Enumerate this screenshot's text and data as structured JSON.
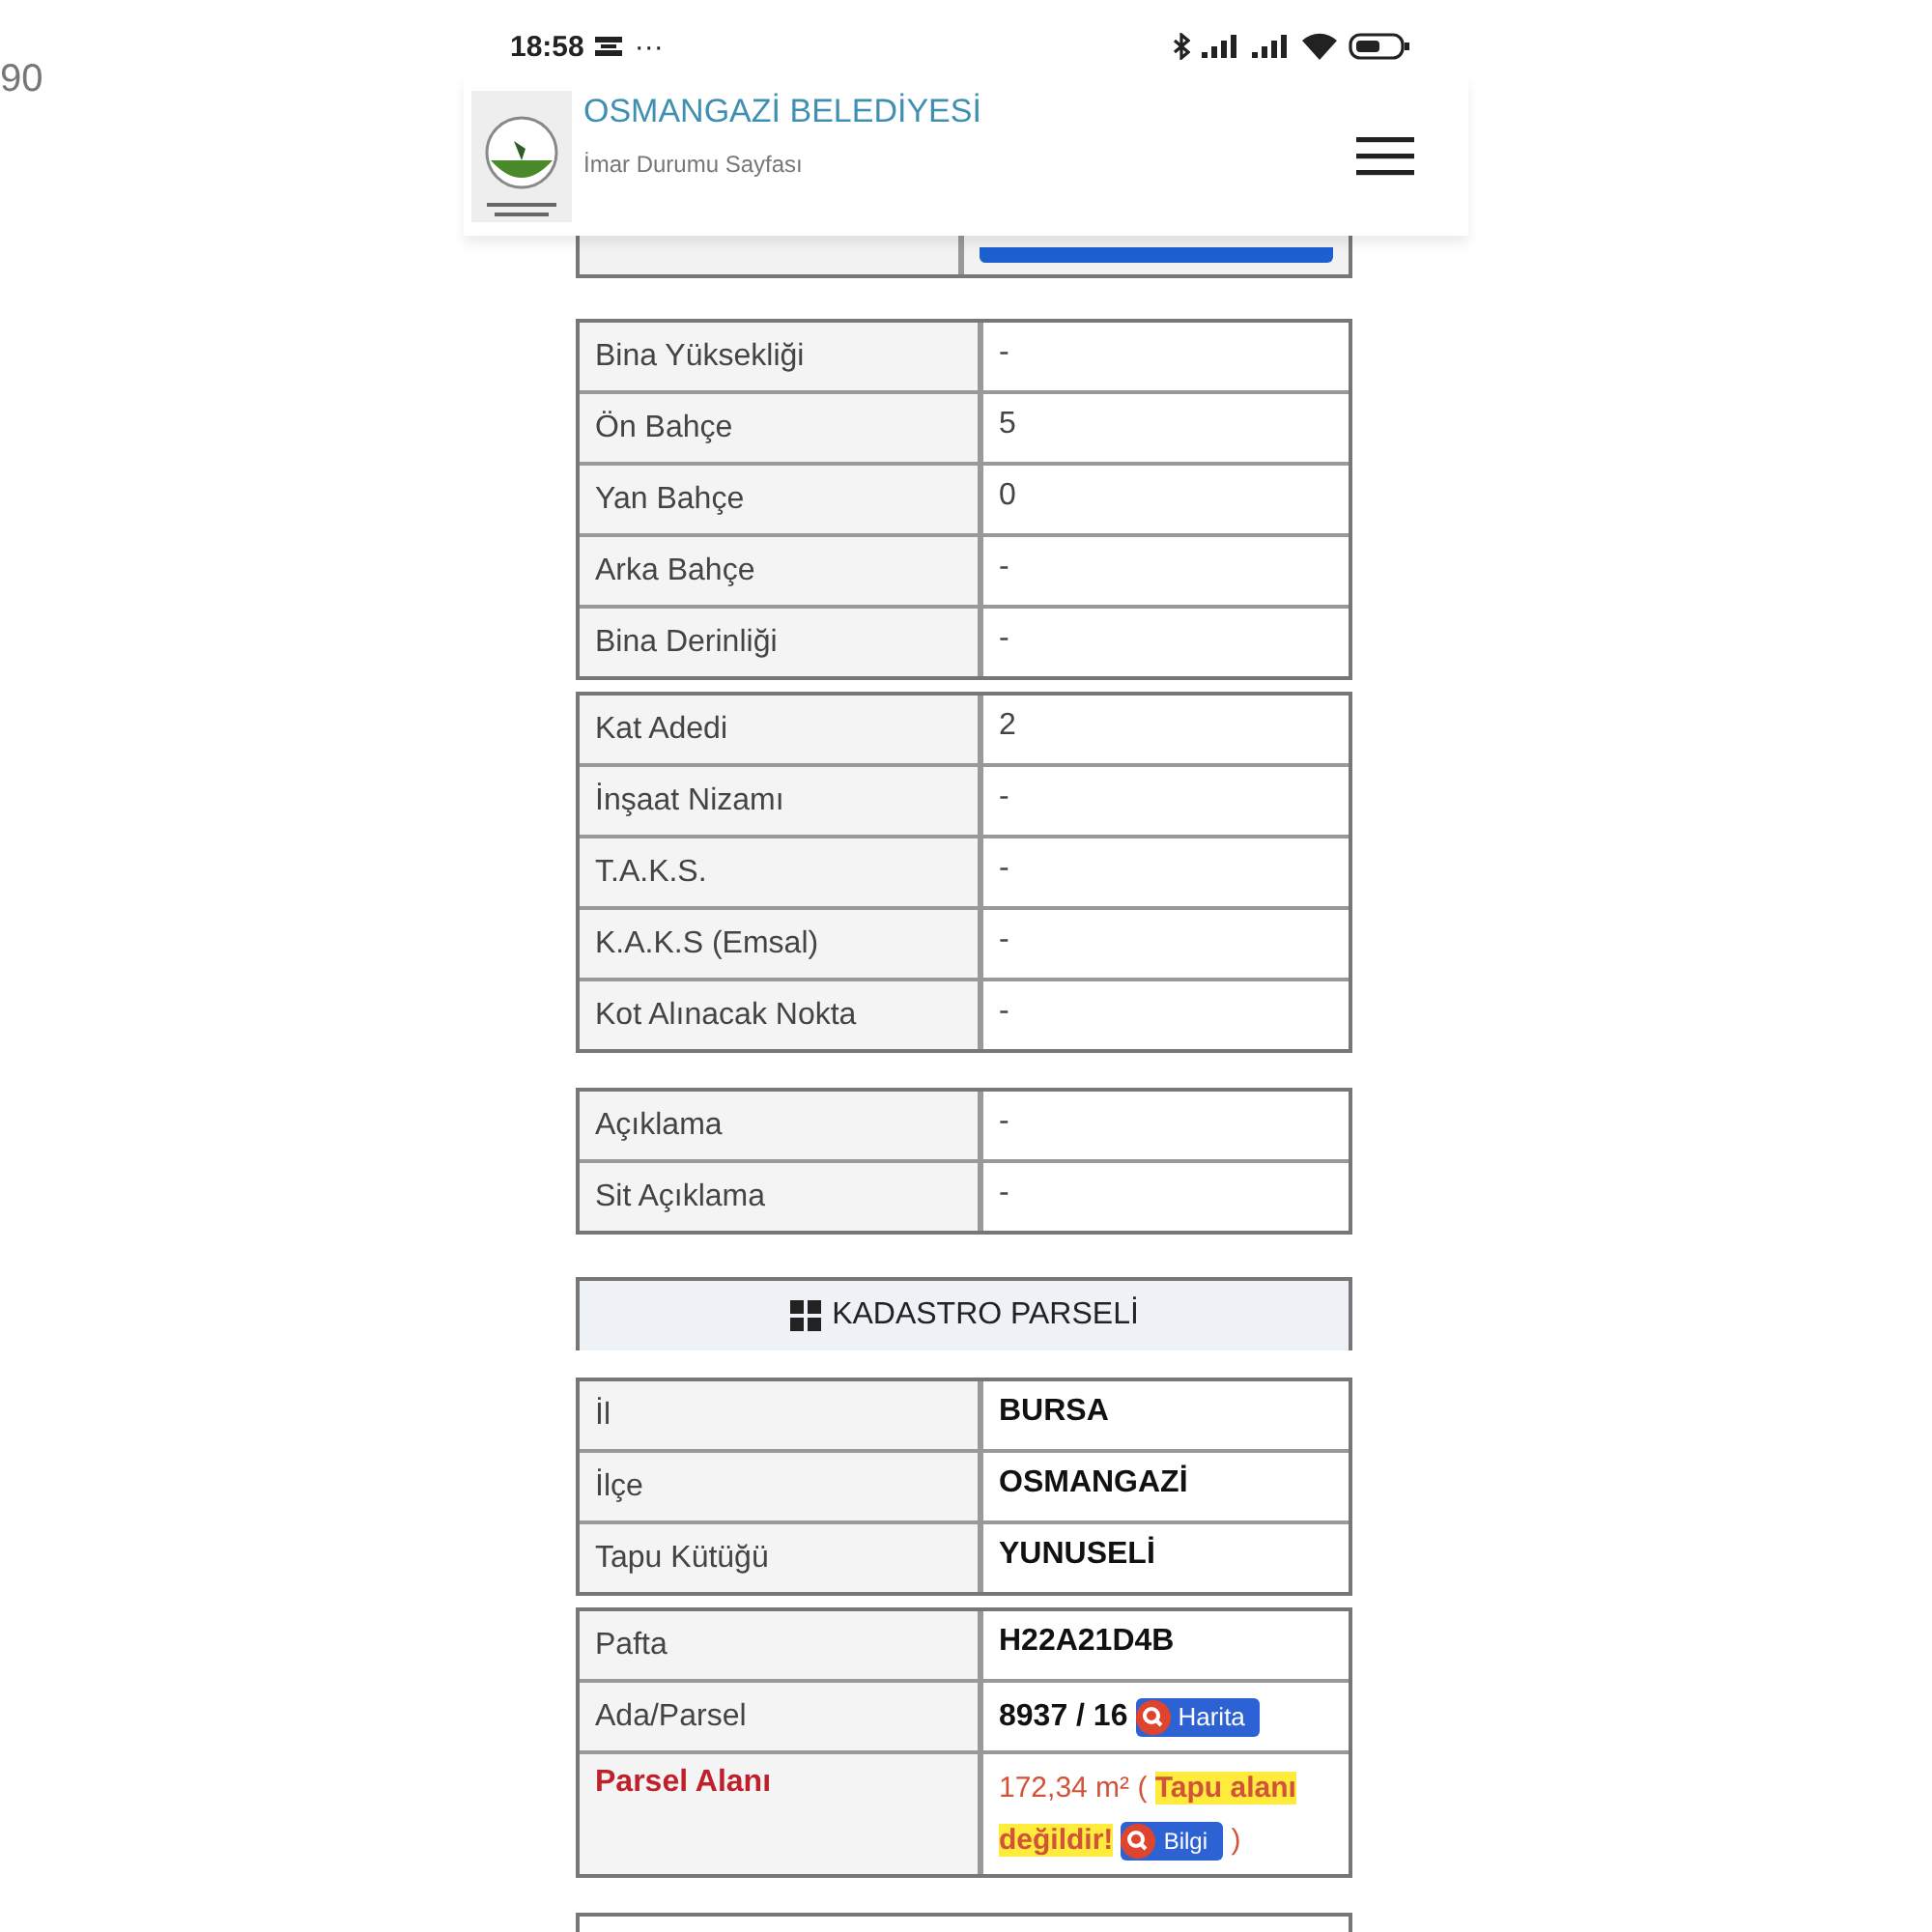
{
  "edge_text": "90",
  "status_bar": {
    "time": "18:58",
    "more": "···"
  },
  "header": {
    "title": "OSMANGAZİ BELEDİYESİ",
    "subtitle": "İmar Durumu Sayfası"
  },
  "groups": [
    {
      "kind": "table",
      "rows": [
        {
          "label": "Bina Yüksekliği",
          "value": "-",
          "kind": "text"
        },
        {
          "label": "Ön Bahçe",
          "value": "5",
          "kind": "text"
        },
        {
          "label": "Yan Bahçe",
          "value": "0",
          "kind": "text"
        },
        {
          "label": "Arka Bahçe",
          "value": "-",
          "kind": "text"
        },
        {
          "label": "Bina Derinliği",
          "value": "-",
          "kind": "text"
        }
      ]
    },
    {
      "kind": "table",
      "rows": [
        {
          "label": "Kat Adedi",
          "value": "2",
          "kind": "text"
        },
        {
          "label": "İnşaat Nizamı",
          "value": "-",
          "kind": "text"
        },
        {
          "label": "T.A.K.S.",
          "value": "-",
          "kind": "text"
        },
        {
          "label": "K.A.K.S (Emsal)",
          "value": "-",
          "kind": "text"
        },
        {
          "label": "Kot Alınacak Nokta",
          "value": "-",
          "kind": "text"
        }
      ]
    },
    {
      "kind": "table",
      "rows": [
        {
          "label": "Açıklama",
          "value": "-",
          "kind": "text"
        },
        {
          "label": "Sit Açıklama",
          "value": "-",
          "kind": "text"
        }
      ]
    },
    {
      "kind": "section",
      "title": "KADASTRO PARSELİ"
    },
    {
      "kind": "table",
      "rows": [
        {
          "label": "İl",
          "value": "BURSA",
          "kind": "bold"
        },
        {
          "label": "İlçe",
          "value": "OSMANGAZİ",
          "kind": "bold"
        },
        {
          "label": "Tapu Kütüğü",
          "value": "YUNUSELİ",
          "kind": "bold"
        }
      ]
    },
    {
      "kind": "table",
      "rows": [
        {
          "label": "Pafta",
          "value": "H22A21D4B",
          "kind": "bold"
        },
        {
          "label": "Ada/Parsel",
          "value": "8937 / 16",
          "kind": "link",
          "button": "Harita"
        },
        {
          "label": "Parsel Alanı",
          "value": "172,34 m² (",
          "kind": "warning",
          "note": "Tapu alanı değildir!",
          "button": "Bilgi",
          "close": ")"
        }
      ]
    }
  ]
}
